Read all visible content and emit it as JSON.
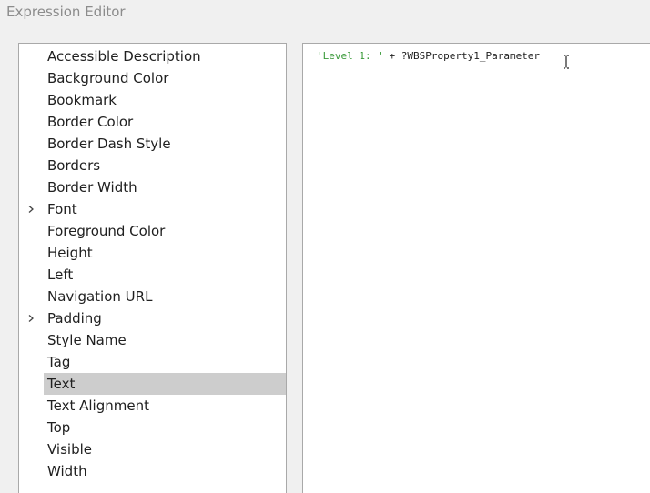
{
  "window": {
    "title": "Expression Editor"
  },
  "properties": {
    "selected_index": 15,
    "items": [
      {
        "label": "Accessible Description",
        "expandable": false
      },
      {
        "label": "Background Color",
        "expandable": false
      },
      {
        "label": "Bookmark",
        "expandable": false
      },
      {
        "label": "Border Color",
        "expandable": false
      },
      {
        "label": "Border Dash Style",
        "expandable": false
      },
      {
        "label": "Borders",
        "expandable": false
      },
      {
        "label": "Border Width",
        "expandable": false
      },
      {
        "label": "Font",
        "expandable": true
      },
      {
        "label": "Foreground Color",
        "expandable": false
      },
      {
        "label": "Height",
        "expandable": false
      },
      {
        "label": "Left",
        "expandable": false
      },
      {
        "label": "Navigation URL",
        "expandable": false
      },
      {
        "label": "Padding",
        "expandable": true
      },
      {
        "label": "Style Name",
        "expandable": false
      },
      {
        "label": "Tag",
        "expandable": false
      },
      {
        "label": "Text",
        "expandable": false
      },
      {
        "label": "Text Alignment",
        "expandable": false
      },
      {
        "label": "Top",
        "expandable": false
      },
      {
        "label": "Visible",
        "expandable": false
      },
      {
        "label": "Width",
        "expandable": false
      }
    ]
  },
  "editor": {
    "expression": {
      "string_literal": "'Level 1: '",
      "operator": " + ",
      "parameter": "?WBSProperty1_Parameter"
    }
  },
  "icons": {
    "expander": "chevron-right-icon",
    "cursor": "text-ibeam-cursor-icon"
  },
  "colors": {
    "selected_row": "#cdcdcd",
    "string_literal": "#3a9a3a",
    "title_text": "#8c8c8c"
  }
}
